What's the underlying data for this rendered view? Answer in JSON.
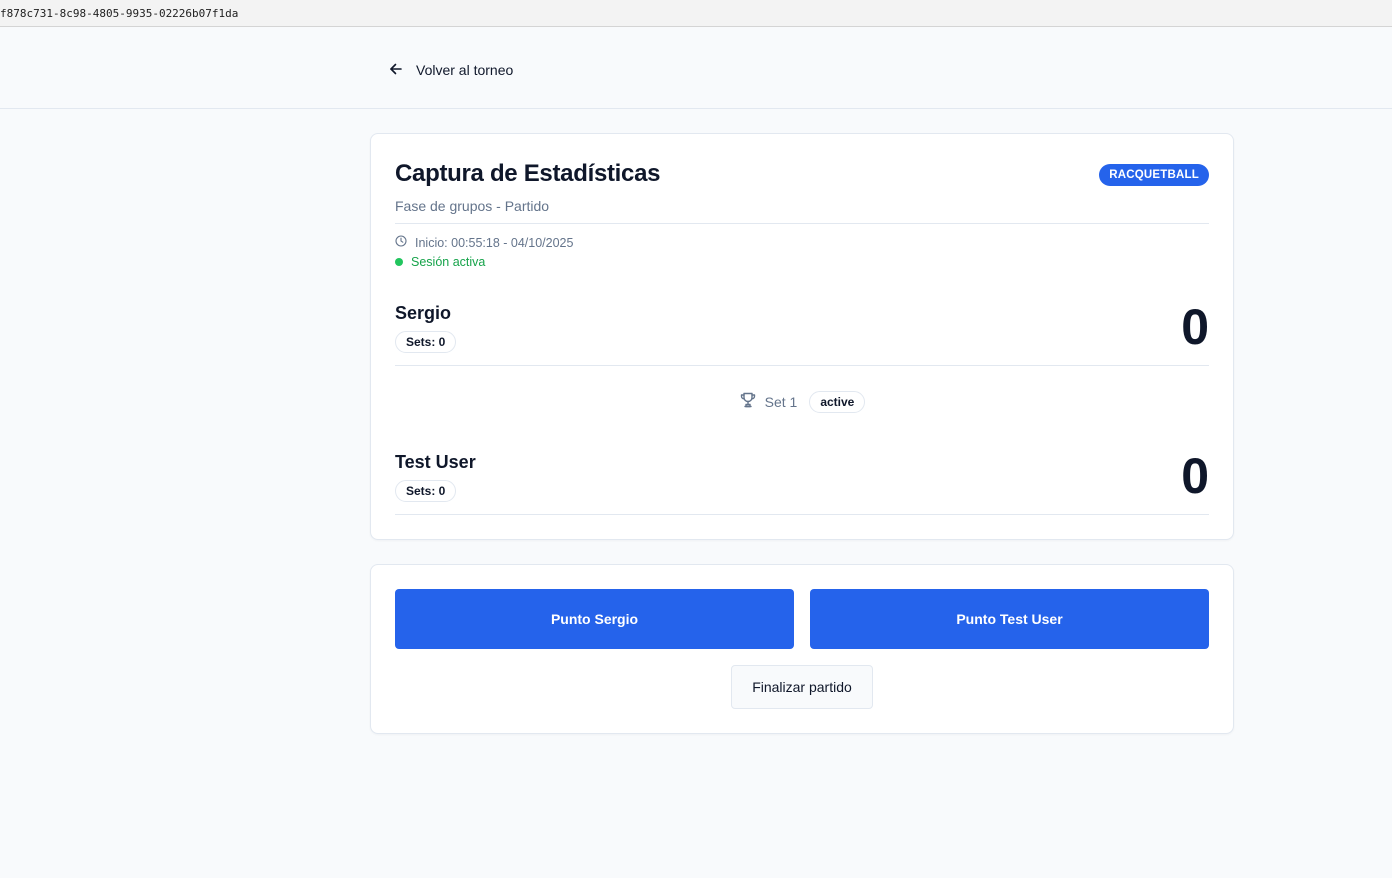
{
  "browser": {
    "url": "f878c731-8c98-4805-9935-02226b07f1da"
  },
  "nav": {
    "back_label": "Volver al torneo"
  },
  "match": {
    "title": "Captura de Estadísticas",
    "sport": "RACQUETBALL",
    "subtitle": "Fase de grupos - Partido",
    "start": "Inicio: 00:55:18 - 04/10/2025",
    "session": "Sesión activa"
  },
  "players": [
    {
      "name": "Sergio",
      "sets": "Sets: 0",
      "score": "0"
    },
    {
      "name": "Test User",
      "sets": "Sets: 0",
      "score": "0"
    }
  ],
  "set": {
    "label": "Set 1",
    "status": "active"
  },
  "actions": {
    "point_a": "Punto Sergio",
    "point_b": "Punto Test User",
    "finish": "Finalizar partido"
  },
  "colors": {
    "primary": "#2563eb",
    "success": "#16a34a",
    "muted": "#64748b",
    "border": "#e2e8f0"
  }
}
